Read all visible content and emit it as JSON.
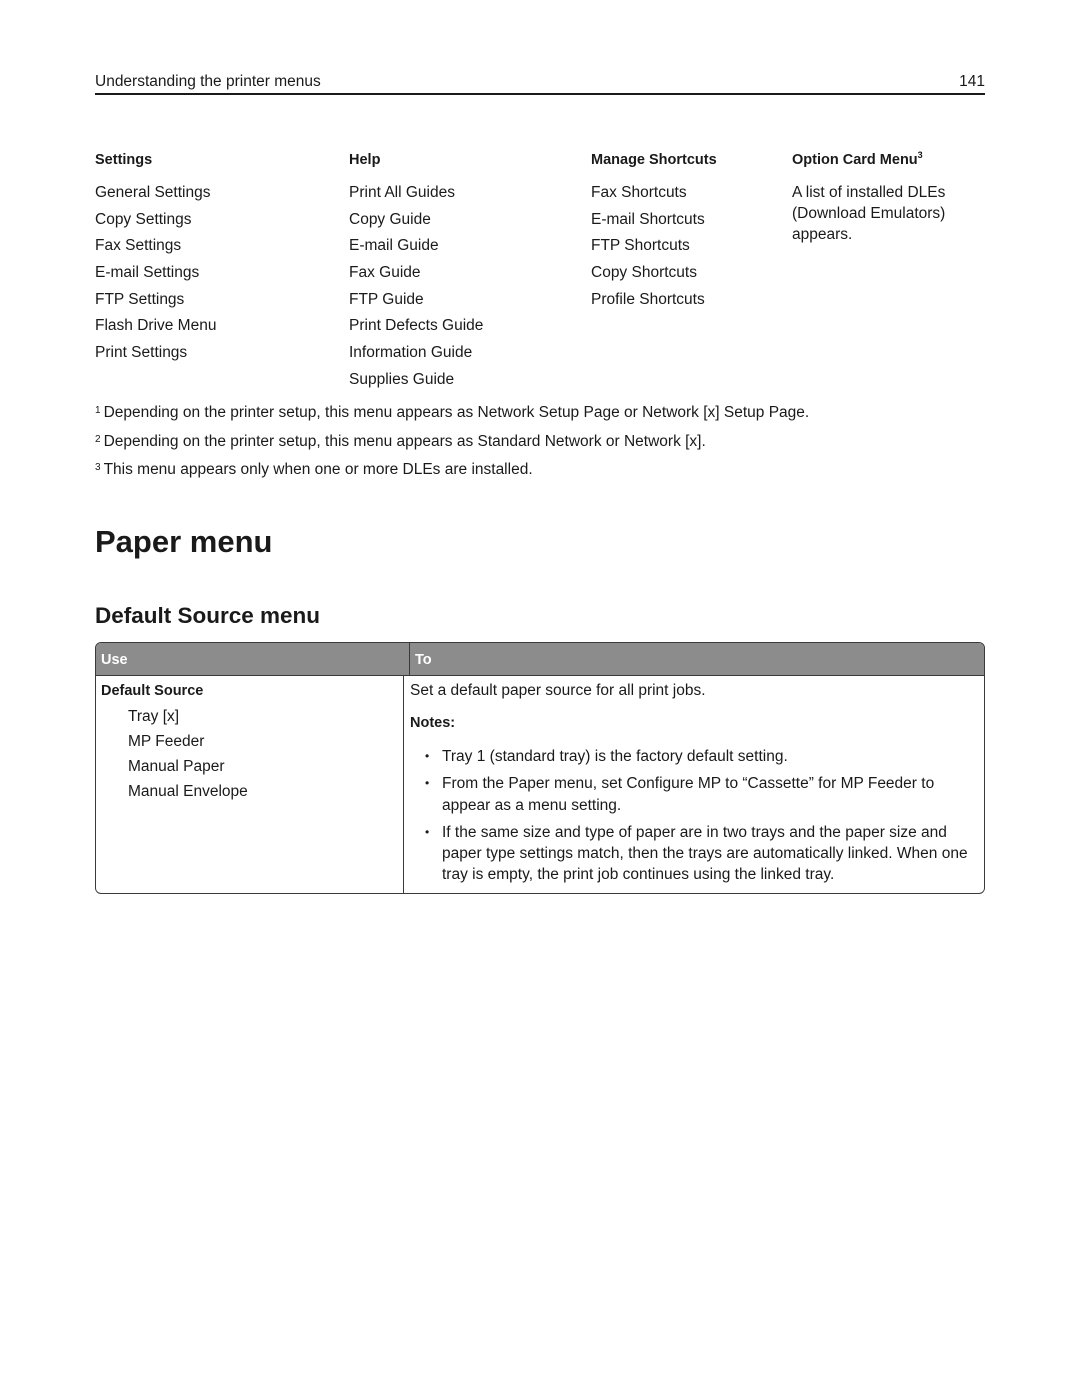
{
  "header": {
    "section_title": "Understanding the printer menus",
    "page_number": "141"
  },
  "menu_columns": [
    {
      "heading": "Settings",
      "items": [
        "General Settings",
        "Copy Settings",
        "Fax Settings",
        "E-mail Settings",
        "FTP Settings",
        "Flash Drive Menu",
        "Print Settings"
      ]
    },
    {
      "heading": "Help",
      "items": [
        "Print All Guides",
        "Copy Guide",
        "E-mail Guide",
        "Fax Guide",
        "FTP Guide",
        "Print Defects Guide",
        "Information Guide",
        "Supplies Guide"
      ]
    },
    {
      "heading": "Manage Shortcuts",
      "items": [
        "Fax Shortcuts",
        "E-mail Shortcuts",
        "FTP Shortcuts",
        "Copy Shortcuts",
        "Profile Shortcuts"
      ]
    },
    {
      "heading": "Option Card Menu",
      "heading_sup": "3",
      "description": "A list of installed DLEs (Download Emulators) appears."
    }
  ],
  "footnotes": [
    {
      "num": "1",
      "text": "Depending on the printer setup, this menu appears as Network Setup Page or Network [x] Setup Page."
    },
    {
      "num": "2",
      "text": "Depending on the printer setup, this menu appears as Standard Network or Network [x]."
    },
    {
      "num": "3",
      "text": "This menu appears only when one or more DLEs are installed."
    }
  ],
  "section": {
    "title": "Paper menu",
    "subtitle": "Default Source menu"
  },
  "table": {
    "headers": {
      "use": "Use",
      "to": "To"
    },
    "header_bg": "#8c8c8c",
    "rows": [
      {
        "use_title": "Default Source",
        "use_options": [
          "Tray [x]",
          "MP Feeder",
          "Manual Paper",
          "Manual Envelope"
        ],
        "to_description": "Set a default paper source for all print jobs.",
        "notes_label": "Notes:",
        "notes": [
          "Tray 1 (standard tray) is the factory default setting.",
          "From the Paper menu, set Configure MP to “Cassette” for MP Feeder to appear as a menu setting.",
          "If the same size and type of paper are in two trays and the paper size and paper type settings match, then the trays are automatically linked. When one tray is empty, the print job continues using the linked tray."
        ]
      }
    ]
  },
  "icons": {
    "bullet": "•"
  }
}
